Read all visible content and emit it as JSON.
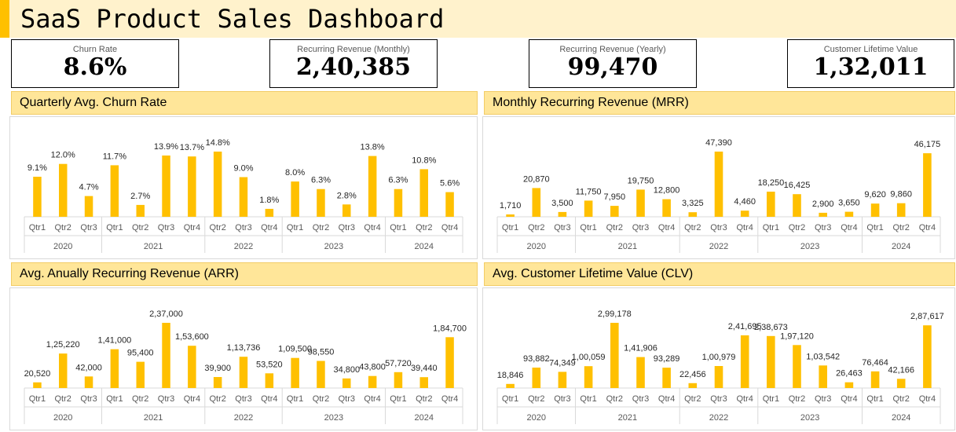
{
  "dashboard": {
    "title": "SaaS Product Sales Dashboard"
  },
  "kpis": [
    {
      "label": "Churn Rate",
      "value": "8.6%"
    },
    {
      "label": "Recurring Revenue (Monthly)",
      "value": "2,40,385"
    },
    {
      "label": "Recurring Revenue (Yearly)",
      "value": "99,470"
    },
    {
      "label": "Customer Lifetime Value",
      "value": "1,32,011"
    }
  ],
  "colors": {
    "accent": "#FFC000",
    "header_fill": "#FFE699",
    "title_fill": "#FFF2CC",
    "bar": "#FFC000"
  },
  "chart_data": [
    {
      "type": "bar",
      "title": "Quarterly Avg. Churn Rate",
      "groups": [
        {
          "year": "2020",
          "quarters": [
            "Qtr1",
            "Qtr2",
            "Qtr3"
          ]
        },
        {
          "year": "2021",
          "quarters": [
            "Qtr1",
            "Qtr2",
            "Qtr3",
            "Qtr4"
          ]
        },
        {
          "year": "2022",
          "quarters": [
            "Qtr2",
            "Qtr3",
            "Qtr4"
          ]
        },
        {
          "year": "2023",
          "quarters": [
            "Qtr1",
            "Qtr2",
            "Qtr3",
            "Qtr4"
          ]
        },
        {
          "year": "2024",
          "quarters": [
            "Qtr1",
            "Qtr2",
            "Qtr4"
          ]
        }
      ],
      "values": [
        9.1,
        12.0,
        4.7,
        11.7,
        2.7,
        13.9,
        13.7,
        14.8,
        9.0,
        1.8,
        8.0,
        6.3,
        2.8,
        13.8,
        6.3,
        10.8,
        5.6
      ],
      "data_labels": [
        "9.1%",
        "12.0%",
        "4.7%",
        "11.7%",
        "2.7%",
        "13.9%",
        "13.7%",
        "14.8%",
        "9.0%",
        "1.8%",
        "8.0%",
        "6.3%",
        "2.8%",
        "13.8%",
        "6.3%",
        "10.8%",
        "5.6%"
      ],
      "grid": false,
      "legend": "none"
    },
    {
      "type": "bar",
      "title": "Monthly Recurring Revenue (MRR)",
      "groups": [
        {
          "year": "2020",
          "quarters": [
            "Qtr1",
            "Qtr2",
            "Qtr3"
          ]
        },
        {
          "year": "2021",
          "quarters": [
            "Qtr1",
            "Qtr2",
            "Qtr3",
            "Qtr4"
          ]
        },
        {
          "year": "2022",
          "quarters": [
            "Qtr2",
            "Qtr3",
            "Qtr4"
          ]
        },
        {
          "year": "2023",
          "quarters": [
            "Qtr1",
            "Qtr2",
            "Qtr3",
            "Qtr4"
          ]
        },
        {
          "year": "2024",
          "quarters": [
            "Qtr1",
            "Qtr2",
            "Qtr4"
          ]
        }
      ],
      "values": [
        1710,
        20870,
        3500,
        11750,
        7950,
        19750,
        12800,
        3325,
        47390,
        4460,
        18250,
        16425,
        2900,
        3650,
        9620,
        9860,
        46175
      ],
      "data_labels": [
        "1,710",
        "20,870",
        "3,500",
        "11,750",
        "7,950",
        "19,750",
        "12,800",
        "3,325",
        "47,390",
        "4,460",
        "18,250",
        "16,425",
        "2,900",
        "3,650",
        "9,620",
        "9,860",
        "46,175"
      ],
      "grid": false,
      "legend": "none"
    },
    {
      "type": "bar",
      "title": "Avg. Anually Recurring Revenue (ARR)",
      "groups": [
        {
          "year": "2020",
          "quarters": [
            "Qtr1",
            "Qtr2",
            "Qtr3"
          ]
        },
        {
          "year": "2021",
          "quarters": [
            "Qtr1",
            "Qtr2",
            "Qtr3",
            "Qtr4"
          ]
        },
        {
          "year": "2022",
          "quarters": [
            "Qtr2",
            "Qtr3",
            "Qtr4"
          ]
        },
        {
          "year": "2023",
          "quarters": [
            "Qtr1",
            "Qtr2",
            "Qtr3",
            "Qtr4"
          ]
        },
        {
          "year": "2024",
          "quarters": [
            "Qtr1",
            "Qtr2",
            "Qtr4"
          ]
        }
      ],
      "values": [
        20520,
        125220,
        42000,
        141000,
        95400,
        237000,
        153600,
        39900,
        113736,
        53520,
        109500,
        98550,
        34800,
        43800,
        57720,
        39440,
        184700
      ],
      "data_labels": [
        "20,520",
        "1,25,220",
        "42,000",
        "1,41,000",
        "95,400",
        "2,37,000",
        "1,53,600",
        "39,900",
        "1,13,736",
        "53,520",
        "1,09,500",
        "98,550",
        "34,800",
        "43,800",
        "57,720",
        "39,440",
        "1,84,700"
      ],
      "grid": false,
      "legend": "none"
    },
    {
      "type": "bar",
      "title": "Avg. Customer Lifetime Value (CLV)",
      "groups": [
        {
          "year": "2020",
          "quarters": [
            "Qtr1",
            "Qtr2",
            "Qtr3"
          ]
        },
        {
          "year": "2021",
          "quarters": [
            "Qtr1",
            "Qtr2",
            "Qtr3",
            "Qtr4"
          ]
        },
        {
          "year": "2022",
          "quarters": [
            "Qtr2",
            "Qtr3",
            "Qtr4"
          ]
        },
        {
          "year": "2023",
          "quarters": [
            "Qtr1",
            "Qtr2",
            "Qtr3",
            "Qtr4"
          ]
        },
        {
          "year": "2024",
          "quarters": [
            "Qtr1",
            "Qtr2",
            "Qtr4"
          ]
        }
      ],
      "values": [
        18846,
        93882,
        74349,
        100059,
        299178,
        141906,
        93289,
        22456,
        100979,
        241695,
        238673,
        197120,
        103542,
        26463,
        76464,
        42166,
        287617
      ],
      "data_labels": [
        "18,846",
        "93,882",
        "74,349",
        "1,00,059",
        "2,99,178",
        "1,41,906",
        "93,289",
        "22,456",
        "1,00,979",
        "2,41,695",
        "2,38,673",
        "1,97,120",
        "1,03,542",
        "26,463",
        "76,464",
        "42,166",
        "2,87,617"
      ],
      "grid": false,
      "legend": "none"
    }
  ]
}
